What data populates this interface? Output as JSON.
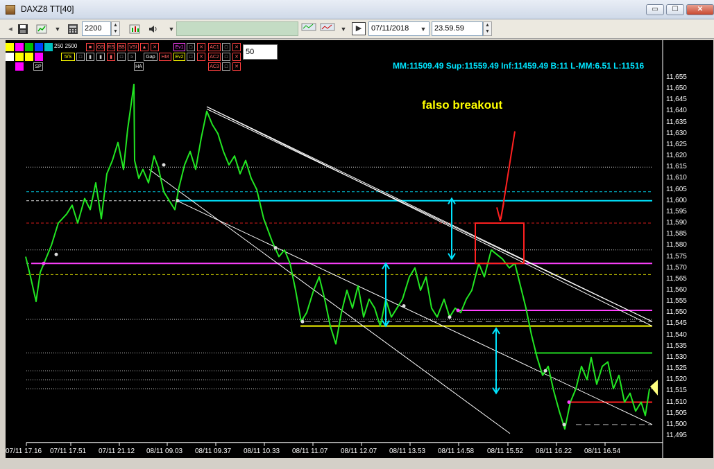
{
  "window": {
    "title": "DAXZ8 TT[40]",
    "min_label": "▭",
    "max_label": "☐",
    "close_label": "✕"
  },
  "toolbar": {
    "qty_value": "2200",
    "date_value": "07/11/2018",
    "time_value": "23.59.59",
    "save_icon": "save-icon",
    "labels": {
      "btn_save": "SAVE",
      "btn_style": "STYLE"
    }
  },
  "indicators": {
    "row1_text": "250  2500",
    "tags": [
      "OS",
      "RS",
      "BB",
      "VSI",
      "Ev1",
      "AC1",
      "Ev2",
      "AC2",
      "AC3",
      "HA",
      "5/S",
      "Gap",
      "HM"
    ],
    "period_value": "50"
  },
  "info": {
    "stats": "MM:11509.49 Sup:11559.49 Inf:11459.49 B:11 L-MM:6.51 L:11516"
  },
  "annotation": {
    "text": "falso breakout"
  },
  "chart_data": {
    "type": "line",
    "title": "",
    "series": [
      {
        "values": []
      }
    ],
    "y_ticks": [
      "11,655",
      "11,650",
      "11,645",
      "11,640",
      "11,635",
      "11,630",
      "11,625",
      "11,620",
      "11,615",
      "11,610",
      "11,605",
      "11,600",
      "11,595",
      "11,590",
      "11,585",
      "11,580",
      "11,575",
      "11,570",
      "11,565",
      "11,560",
      "11,555",
      "11,550",
      "11,545",
      "11,540",
      "11,535",
      "11,530",
      "11,525",
      "11,520",
      "11,515",
      "11,510",
      "11,505",
      "11,500",
      "11,495"
    ],
    "x_ticks": [
      "07/11 17.16",
      "07/11 17.51",
      "07/11 21.12",
      "08/11 09.03",
      "08/11 09.37",
      "08/11 10.33",
      "08/11 11.07",
      "08/11 12.07",
      "08/11 13.53",
      "08/11 14.58",
      "08/11 15.52",
      "08/11 16.22",
      "08/11 16.54"
    ],
    "ylim": [
      11492,
      11657
    ],
    "price_path": [
      [
        11575,
        37
      ],
      [
        11566,
        44
      ],
      [
        11555,
        52
      ],
      [
        11568,
        58
      ],
      [
        11574,
        66
      ],
      [
        11580,
        74
      ],
      [
        11590,
        84
      ],
      [
        11594,
        96
      ],
      [
        11598,
        104
      ],
      [
        11590,
        112
      ],
      [
        11601,
        122
      ],
      [
        11596,
        130
      ],
      [
        11608,
        138
      ],
      [
        11592,
        146
      ],
      [
        11612,
        154
      ],
      [
        11618,
        162
      ],
      [
        11626,
        170
      ],
      [
        11614,
        178
      ],
      [
        11632,
        184
      ],
      [
        11652,
        193
      ],
      [
        11618,
        194
      ],
      [
        11610,
        200
      ],
      [
        11614,
        206
      ],
      [
        11608,
        214
      ],
      [
        11620,
        222
      ],
      [
        11615,
        228
      ],
      [
        11604,
        236
      ],
      [
        11600,
        244
      ],
      [
        11596,
        252
      ],
      [
        11606,
        258
      ],
      [
        11616,
        266
      ],
      [
        11622,
        274
      ],
      [
        11614,
        282
      ],
      [
        11628,
        290
      ],
      [
        11640,
        298
      ],
      [
        11634,
        306
      ],
      [
        11630,
        314
      ],
      [
        11622,
        322
      ],
      [
        11616,
        330
      ],
      [
        11620,
        338
      ],
      [
        11612,
        346
      ],
      [
        11618,
        354
      ],
      [
        11610,
        362
      ],
      [
        11605,
        370
      ],
      [
        11592,
        380
      ],
      [
        11582,
        392
      ],
      [
        11575,
        402
      ],
      [
        11578,
        410
      ],
      [
        11572,
        418
      ],
      [
        11560,
        426
      ],
      [
        11546,
        434
      ],
      [
        11550,
        442
      ],
      [
        11560,
        452
      ],
      [
        11566,
        460
      ],
      [
        11556,
        468
      ],
      [
        11544,
        476
      ],
      [
        11536,
        484
      ],
      [
        11550,
        492
      ],
      [
        11560,
        500
      ],
      [
        11552,
        508
      ],
      [
        11562,
        516
      ],
      [
        11548,
        524
      ],
      [
        11556,
        532
      ],
      [
        11552,
        540
      ],
      [
        11544,
        548
      ],
      [
        11556,
        556
      ],
      [
        11548,
        564
      ],
      [
        11552,
        572
      ],
      [
        11556,
        580
      ],
      [
        11566,
        590
      ],
      [
        11570,
        598
      ],
      [
        11560,
        606
      ],
      [
        11566,
        614
      ],
      [
        11552,
        622
      ],
      [
        11548,
        630
      ],
      [
        11556,
        640
      ],
      [
        11548,
        648
      ],
      [
        11552,
        656
      ],
      [
        11550,
        664
      ],
      [
        11556,
        672
      ],
      [
        11560,
        680
      ],
      [
        11572,
        690
      ],
      [
        11566,
        698
      ],
      [
        11578,
        708
      ],
      [
        11576,
        716
      ],
      [
        11574,
        724
      ],
      [
        11570,
        734
      ],
      [
        11572,
        742
      ],
      [
        11562,
        750
      ],
      [
        11552,
        758
      ],
      [
        11540,
        766
      ],
      [
        11530,
        774
      ],
      [
        11522,
        782
      ],
      [
        11526,
        790
      ],
      [
        11515,
        798
      ],
      [
        11506,
        806
      ],
      [
        11498,
        814
      ],
      [
        11510,
        822
      ],
      [
        11516,
        830
      ],
      [
        11526,
        838
      ],
      [
        11520,
        846
      ],
      [
        11530,
        852
      ],
      [
        11518,
        860
      ],
      [
        11526,
        868
      ],
      [
        11528,
        876
      ],
      [
        11516,
        884
      ],
      [
        11522,
        892
      ],
      [
        11510,
        900
      ],
      [
        11514,
        908
      ],
      [
        11506,
        916
      ],
      [
        11510,
        924
      ],
      [
        11504,
        930
      ],
      [
        11516,
        936
      ]
    ],
    "h_lines": [
      {
        "y": 11615,
        "color": "#ffffff",
        "style": "dotted"
      },
      {
        "y": 11604,
        "color": "#00e5ff",
        "style": "dashed"
      },
      {
        "y": 11600,
        "color": "#ffffff",
        "style": "dashed"
      },
      {
        "y": 11590,
        "color": "#ff2020",
        "style": "dashed"
      },
      {
        "y": 11578,
        "color": "#ffffff",
        "style": "dotted"
      },
      {
        "y": 11572,
        "color": "#ff40ff",
        "style": "dashed"
      },
      {
        "y": 11567,
        "color": "#ffff00",
        "style": "dashed"
      },
      {
        "y": 11547,
        "color": "#ffffff",
        "style": "dotted"
      },
      {
        "y": 11532,
        "color": "#ffffff",
        "style": "dotted"
      },
      {
        "y": 11524,
        "color": "#ffffff",
        "style": "dotted"
      },
      {
        "y": 11520,
        "color": "#ffffff",
        "style": "dotted"
      },
      {
        "y": 11516,
        "color": "#ffffff",
        "style": "dotted"
      }
    ],
    "support_lines": [
      {
        "y": 11600,
        "color": "#00e5ff"
      },
      {
        "y": 11544,
        "color": "#ffff00"
      },
      {
        "y": 11551,
        "color": "#ff40ff"
      },
      {
        "y": 11572,
        "color": "#ff40ff"
      },
      {
        "y": 11532,
        "color": "#22dd22"
      },
      {
        "y": 11510,
        "color": "#ff2020"
      }
    ],
    "colors": {
      "price": "#22e622",
      "arrow": "#00e5ff",
      "box": "#ff2020",
      "trend": "#ffffff",
      "marker": "#ff40ff"
    }
  }
}
